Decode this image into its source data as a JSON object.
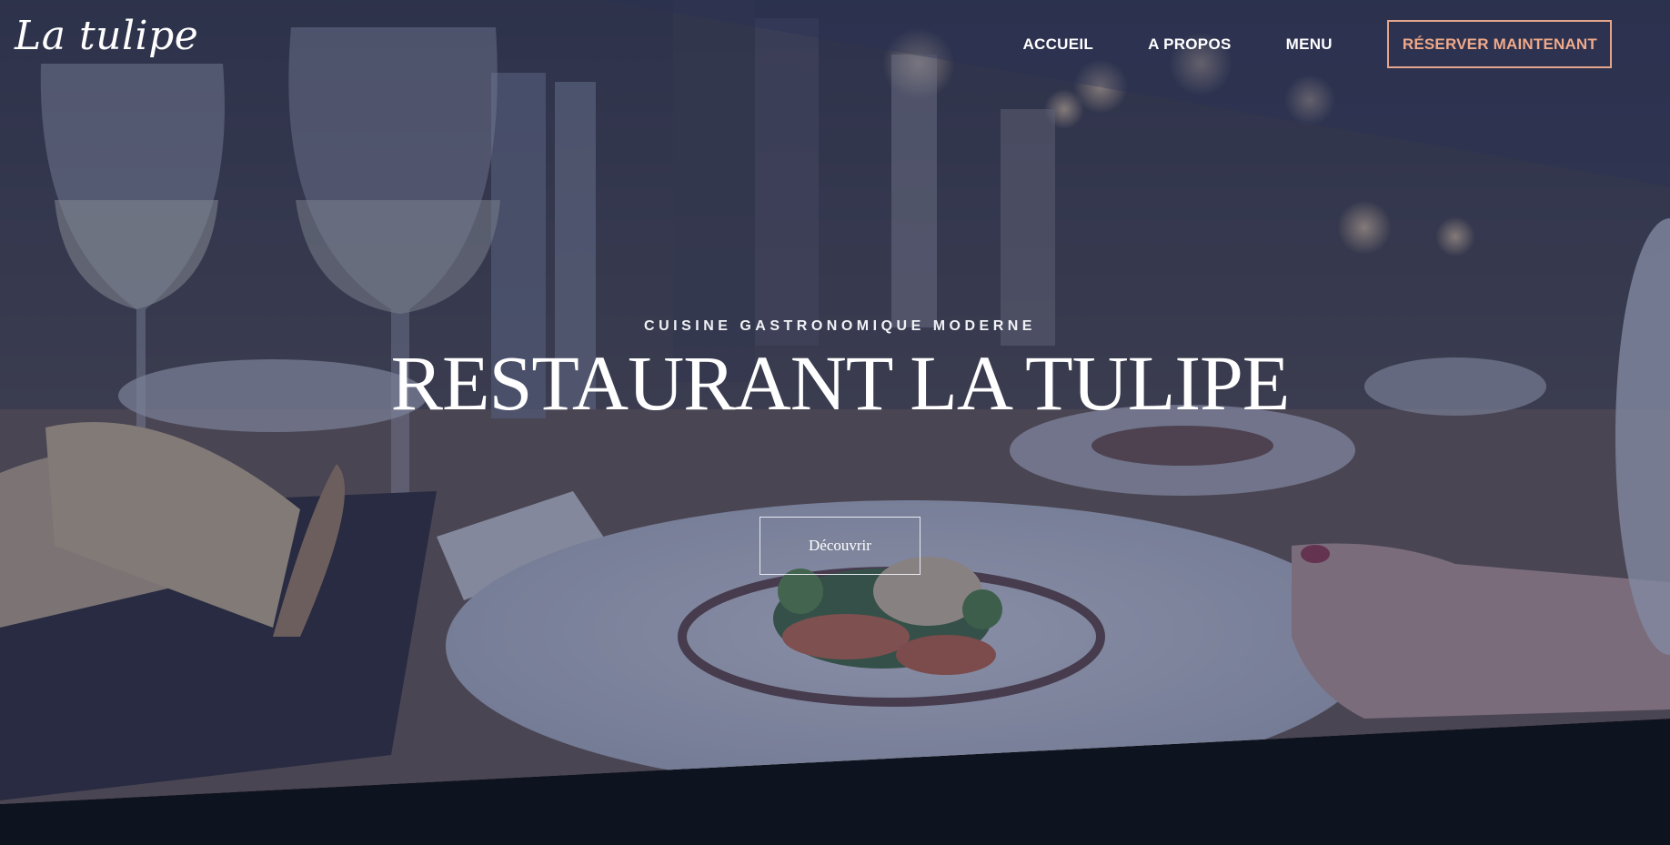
{
  "header": {
    "logo": "La tulipe",
    "nav": [
      {
        "label": "ACCUEIL"
      },
      {
        "label": "A PROPOS"
      },
      {
        "label": "MENU"
      }
    ],
    "reserve_label": "RÉSERVER MAINTENANT"
  },
  "hero": {
    "tagline": "CUISINE GASTRONOMIQUE MODERNE",
    "title": "RESTAURANT LA TULIPE",
    "cta_label": "Découvrir",
    "background_image": "restaurant-table-plated-dish-photo"
  },
  "colors": {
    "accent": "#f0a98a",
    "overlay": "#303a62",
    "footer_background": "#0e1320",
    "text": "#ffffff"
  }
}
